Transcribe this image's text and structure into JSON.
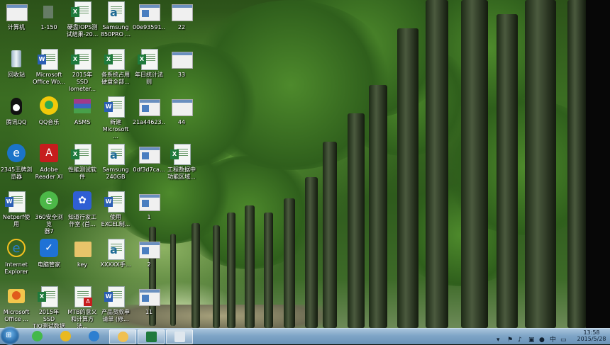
{
  "desktop": {
    "icons": [
      {
        "label": "计算机",
        "icon": "computer-icon"
      },
      {
        "label": "回收站",
        "icon": "recycle-bin-icon"
      },
      {
        "label": "腾讯QQ",
        "icon": "qq-penguin-icon"
      },
      {
        "label": "2345王牌浏\n览器",
        "icon": "browser-e-icon"
      },
      {
        "label": "Netperf使用",
        "icon": "document-icon"
      },
      {
        "label": "Internet\nExplorer",
        "icon": "ie-icon"
      },
      {
        "label": "Microsoft\nOffice ...",
        "icon": "office-upload-icon"
      },
      {
        "label": "1-150",
        "icon": "image-icon"
      },
      {
        "label": "Microsoft\nOffice Wo...",
        "icon": "word-icon"
      },
      {
        "label": "QQ音乐",
        "icon": "qq-music-icon"
      },
      {
        "label": "Adobe\nReader XI",
        "icon": "pdf-reader-icon"
      },
      {
        "label": "360安全浏览\n器7",
        "icon": "browser-360-icon"
      },
      {
        "label": "电脑管家",
        "icon": "pc-manager-icon"
      },
      {
        "label": "2015年 SSD\nTIO测试数据",
        "icon": "excel-file-icon"
      },
      {
        "label": "硬盘IOPS测\n试结果-20...",
        "icon": "excel-file-icon"
      },
      {
        "label": "2015年 SSD\nIometer...",
        "icon": "excel-file-icon"
      },
      {
        "label": "ASMS",
        "icon": "archive-icon"
      },
      {
        "label": "性能测试软\n件",
        "icon": "excel-file-icon"
      },
      {
        "label": "知道行家工\n作室 (首...",
        "icon": "paw-icon"
      },
      {
        "label": "key",
        "icon": "folder-icon"
      },
      {
        "label": "MTB的意义\n和计算方法...",
        "icon": "pdf-file-icon"
      },
      {
        "label": "Samsung\n850PRO ...",
        "icon": "text-a-icon"
      },
      {
        "label": "各系统占用\n硬盘全部...",
        "icon": "excel-file-icon"
      },
      {
        "label": "新建\nMicrosoft ...",
        "icon": "word-file-icon"
      },
      {
        "label": "Samsung\n240GB",
        "icon": "text-a-icon"
      },
      {
        "label": "使用\nEXCEL制...",
        "icon": "word-file-icon"
      },
      {
        "label": "XXXXX手...",
        "icon": "text-a-icon"
      },
      {
        "label": "产品货款申\n请单 (修...",
        "icon": "word-file-icon"
      },
      {
        "label": "00e93591...",
        "icon": "image-file-icon"
      },
      {
        "label": "年日统计法\n则",
        "icon": "excel-file-icon"
      },
      {
        "label": "21a44623...",
        "icon": "image-file-icon"
      },
      {
        "label": "0df3d7ca...",
        "icon": "image-file-icon"
      },
      {
        "label": "1",
        "icon": "image-file-icon"
      },
      {
        "label": "2",
        "icon": "image-file-icon"
      },
      {
        "label": "11",
        "icon": "image-file-icon"
      },
      {
        "label": "22",
        "icon": "window-file-icon"
      },
      {
        "label": "33",
        "icon": "window-file-icon"
      },
      {
        "label": "44",
        "icon": "window-file-icon"
      },
      {
        "label": "工程数据中\n功能区域...",
        "icon": "excel-file-icon"
      }
    ]
  },
  "taskbar": {
    "pinned": [
      {
        "icon": "360-browser-icon",
        "color": "#44b84a"
      },
      {
        "icon": "qq-music-icon",
        "color": "#e9b920"
      },
      {
        "icon": "ie-icon",
        "color": "#2d7fd0"
      },
      {
        "icon": "folder-icon",
        "color": "#f0c050"
      },
      {
        "icon": "excel-icon",
        "color": "#1f7a3c"
      },
      {
        "icon": "notepad-icon",
        "color": "#dfe7ee"
      }
    ],
    "tray_icons": [
      "shield-icon",
      "flag-icon",
      "volume-icon",
      "network-icon",
      "qq-icon",
      "ime-icon",
      "battery-icon"
    ],
    "clock": {
      "time": "13:58",
      "date": "2015/5/28"
    }
  }
}
